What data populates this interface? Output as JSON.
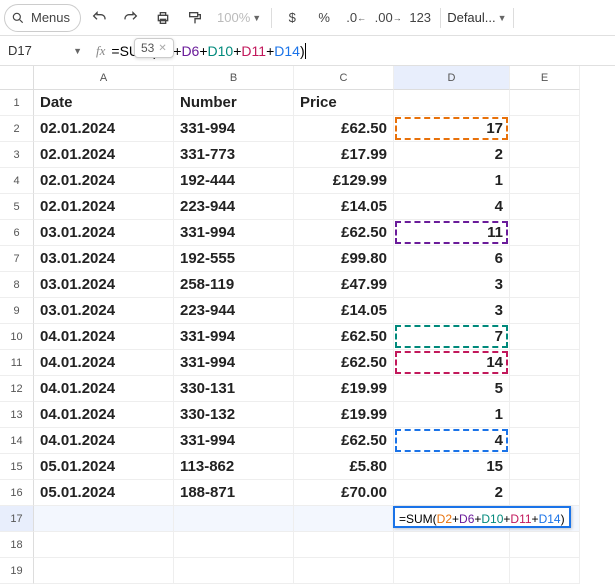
{
  "toolbar": {
    "menus_label": "Menus",
    "zoom": "100%",
    "currency": "$",
    "percent": "%",
    "dec_dec": ".0",
    "inc_dec": ".00",
    "num_fmt": "123",
    "font": "Defaul..."
  },
  "tooltip": {
    "value": "53"
  },
  "namebox": {
    "ref": "D17"
  },
  "formula": {
    "prefix": "=SUM(",
    "refs": [
      "D2",
      "D6",
      "D10",
      "D11",
      "D14"
    ],
    "suffix": ")"
  },
  "columns": [
    "A",
    "B",
    "C",
    "D",
    "E"
  ],
  "headers": {
    "date": "Date",
    "number": "Number",
    "price": "Price"
  },
  "rows": [
    {
      "date": "02.01.2024",
      "number": "331-994",
      "price": "£62.50",
      "qty": "17",
      "hl": 1
    },
    {
      "date": "02.01.2024",
      "number": "331-773",
      "price": "£17.99",
      "qty": "2"
    },
    {
      "date": "02.01.2024",
      "number": "192-444",
      "price": "£129.99",
      "qty": "1"
    },
    {
      "date": "02.01.2024",
      "number": "223-944",
      "price": "£14.05",
      "qty": "4"
    },
    {
      "date": "03.01.2024",
      "number": "331-994",
      "price": "£62.50",
      "qty": "11",
      "hl": 2
    },
    {
      "date": "03.01.2024",
      "number": "192-555",
      "price": "£99.80",
      "qty": "6"
    },
    {
      "date": "03.01.2024",
      "number": "258-119",
      "price": "£47.99",
      "qty": "3"
    },
    {
      "date": "03.01.2024",
      "number": "223-944",
      "price": "£14.05",
      "qty": "3"
    },
    {
      "date": "04.01.2024",
      "number": "331-994",
      "price": "£62.50",
      "qty": "7",
      "hl": 3
    },
    {
      "date": "04.01.2024",
      "number": "331-994",
      "price": "£62.50",
      "qty": "14",
      "hl": 4
    },
    {
      "date": "04.01.2024",
      "number": "330-131",
      "price": "£19.99",
      "qty": "5"
    },
    {
      "date": "04.01.2024",
      "number": "330-132",
      "price": "£19.99",
      "qty": "1"
    },
    {
      "date": "04.01.2024",
      "number": "331-994",
      "price": "£62.50",
      "qty": "4",
      "hl": 5
    },
    {
      "date": "05.01.2024",
      "number": "113-862",
      "price": "£5.80",
      "qty": "15"
    },
    {
      "date": "05.01.2024",
      "number": "188-871",
      "price": "£70.00",
      "qty": "2"
    }
  ],
  "active_row": 17
}
